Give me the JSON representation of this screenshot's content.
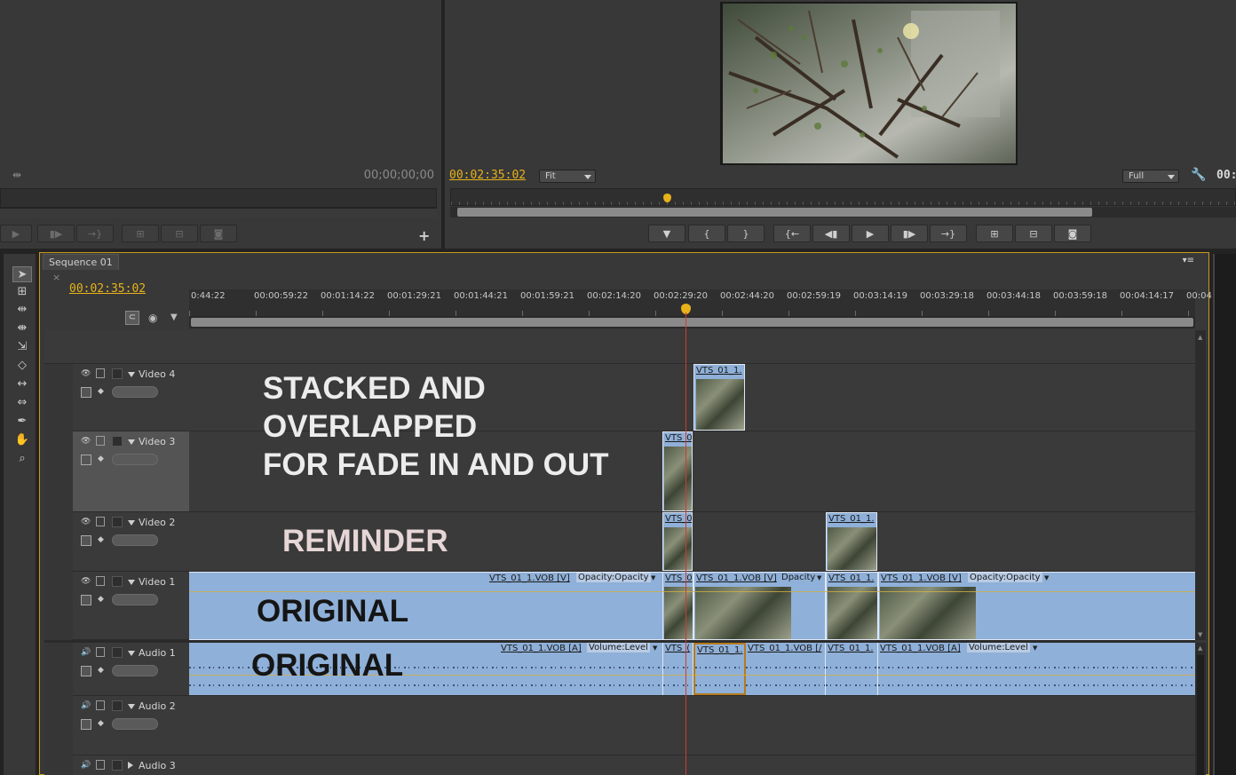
{
  "source_monitor": {
    "timecode": "00;00;00;00"
  },
  "program_monitor": {
    "timecode": "00:02:35:02",
    "zoom_select": "Fit",
    "quality_select": "Full",
    "timecode_right": "00:"
  },
  "sequence": {
    "tab_label": "Sequence 01",
    "tab_close": "×",
    "playhead_timecode": "00:02:35:02",
    "ruler_labels": [
      "0:44:22",
      "00:00:59:22",
      "00:01:14:22",
      "00:01:29:21",
      "00:01:44:21",
      "00:01:59:21",
      "00:02:14:20",
      "00:02:29:20",
      "00:02:44:20",
      "00:02:59:19",
      "00:03:14:19",
      "00:03:29:18",
      "00:03:44:18",
      "00:03:59:18",
      "00:04:14:17",
      "00:04"
    ]
  },
  "tracks": {
    "video4": "Video 4",
    "video3": "Video 3",
    "video2": "Video 2",
    "video1": "Video 1",
    "audio1": "Audio 1",
    "audio2": "Audio 2",
    "audio3": "Audio 3"
  },
  "clips": {
    "v4_a": "VTS_01_1.",
    "v3_a": "VTS_0",
    "v2_a": "VTS_0",
    "v2_b": "VTS_01_1.",
    "v1_main": "VTS_01_1.VOB [V]",
    "v1_main_fx": "Opacity:Opacity",
    "v1_b": "VTS_0",
    "v1_c": "VTS_01_1.VOB [V]",
    "v1_c_fx": "Dpacity",
    "v1_d": "VTS_01_1.",
    "v1_e": "VTS_01_1.VOB [V]",
    "v1_e_fx": "Opacity:Opacity",
    "a1_main": "VTS_01_1.VOB [A]",
    "a1_main_fx": "Volume:Level",
    "a1_b": "VTS_(",
    "a1_c": "VTS_01_1.",
    "a1_d": "VTS_01_1.VOB [/",
    "a1_e": "VTS_01_1.",
    "a1_f": "VTS_01_1.VOB [A]",
    "a1_f_fx": "Volume:Level"
  },
  "annotations": {
    "stacked_line1": "STACKED AND",
    "stacked_line2": "OVERLAPPED",
    "stacked_line3": "FOR FADE IN AND OUT",
    "reminder": "REMINDER",
    "original_video": "ORIGINAL",
    "original_audio": "ORIGINAL"
  },
  "colors": {
    "timecode": "#e8b21a",
    "clip_fill": "#8fb0d8",
    "playhead": "#d43a2c",
    "panel_bg": "#383838"
  }
}
